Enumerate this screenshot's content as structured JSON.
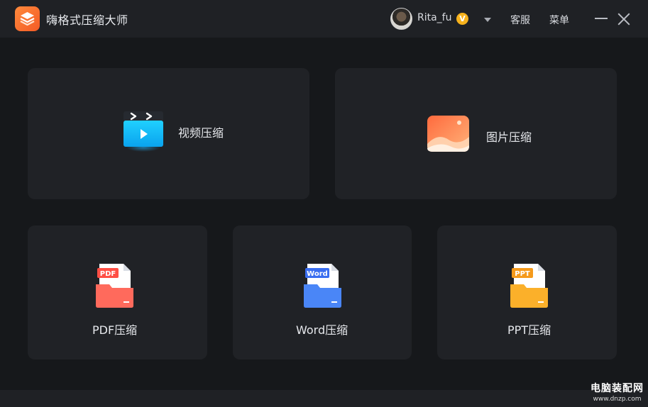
{
  "app": {
    "title": "嗨格式压缩大师"
  },
  "user": {
    "name": "Rita_fu",
    "badge": "V"
  },
  "header": {
    "service_label": "客服",
    "menu_label": "菜单"
  },
  "cards": {
    "video": {
      "label": "视频压缩",
      "icon": "video-icon"
    },
    "image": {
      "label": "图片压缩",
      "icon": "image-icon"
    },
    "pdf": {
      "label": "PDF压缩",
      "icon": "pdf-file-icon",
      "tag": "PDF",
      "color": "#ff5a4f"
    },
    "word": {
      "label": "Word压缩",
      "icon": "word-file-icon",
      "tag": "Word",
      "color": "#3f7df5"
    },
    "ppt": {
      "label": "PPT压缩",
      "icon": "ppt-file-icon",
      "tag": "PPT",
      "color": "#f7a21c"
    }
  },
  "watermark": {
    "line1": "电脑装配网",
    "line2": "www.dnzp.com"
  }
}
